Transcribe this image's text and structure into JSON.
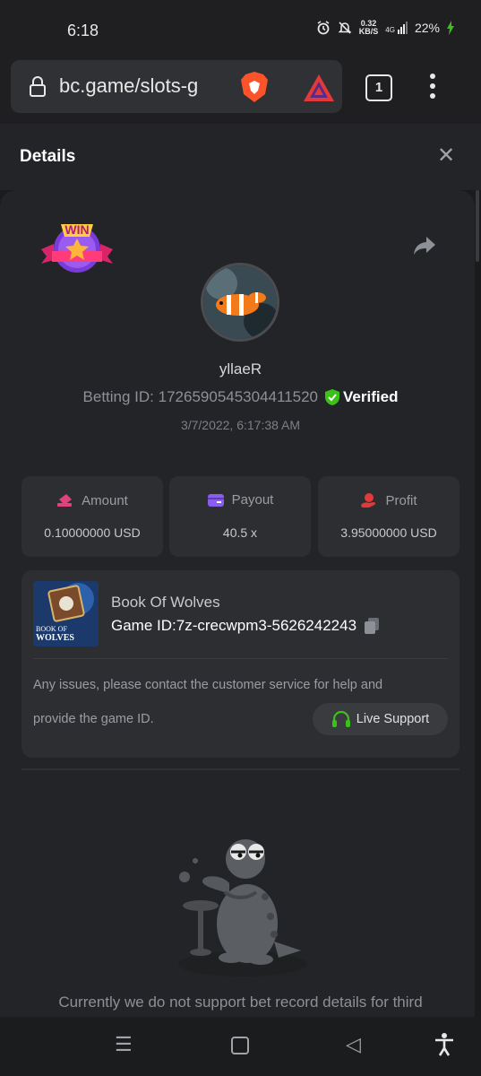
{
  "status": {
    "time": "6:18",
    "net_speed_value": "0.32",
    "net_speed_unit": "KB/S",
    "network": "4G",
    "battery": "22%"
  },
  "browser": {
    "url": "bc.game/slots-g",
    "tab_count": "1"
  },
  "details": {
    "title": "Details",
    "username": "yllaeR",
    "betting_id_label": "Betting ID:",
    "betting_id": "1726590545304411520",
    "verified_label": "Verified",
    "datetime": "3/7/2022, 6:17:38 AM",
    "badge_text": "WIN"
  },
  "stats": {
    "amount": {
      "label": "Amount",
      "value": "0.10000000 USD"
    },
    "payout": {
      "label": "Payout",
      "value": "40.5 x"
    },
    "profit": {
      "label": "Profit",
      "value": "3.95000000 USD"
    }
  },
  "game": {
    "name": "Book Of Wolves",
    "id_label": "Game ID:",
    "id": "7z-crecwpm3-5626242243",
    "thumb_text_1": "BOOK OF",
    "thumb_text_2": "WOLVES",
    "help_line_1": "Any issues, please contact the customer service for help and",
    "help_line_2": "provide the game ID.",
    "support_label": "Live Support"
  },
  "notice": "Currently we do not support bet record details for third",
  "colors": {
    "accent_green": "#3bc117",
    "amount_icon": "#e0437a",
    "payout_icon": "#8a5cf0",
    "profit_icon": "#e23a3a",
    "background": "#1a1b1d",
    "panel": "#232427",
    "card": "#2d2e31"
  }
}
